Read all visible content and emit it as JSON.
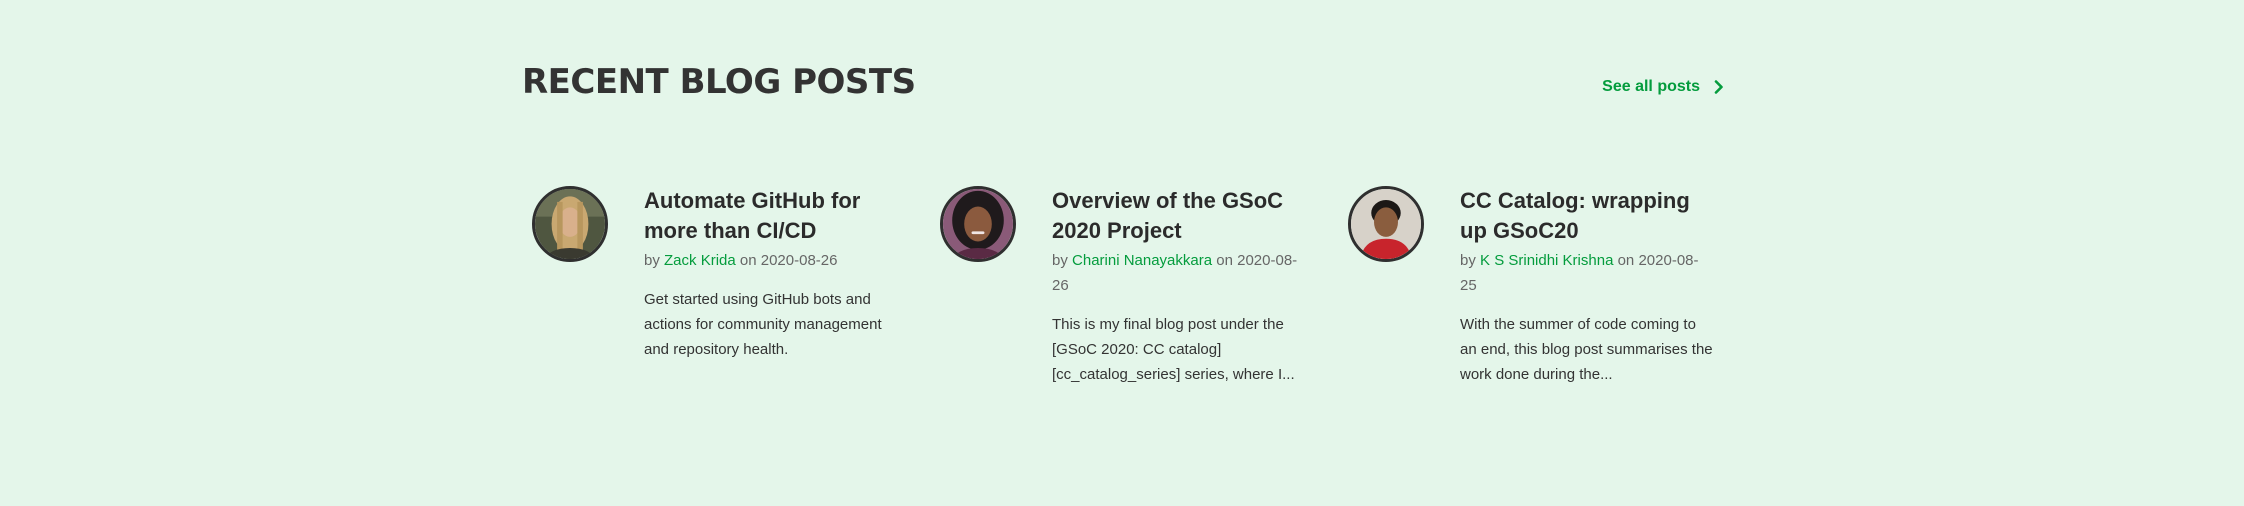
{
  "section": {
    "title": "RECENT BLOG POSTS",
    "see_all_label": "See all posts"
  },
  "posts": [
    {
      "title": "Automate GitHub for more than CI/CD",
      "by": "by",
      "author": "Zack Krida",
      "on": "on",
      "date": "2020-08-26",
      "excerpt": "Get started using GitHub bots and actions for community management and repository health."
    },
    {
      "title": "Overview of the GSoC 2020 Project",
      "by": "by",
      "author": "Charini Nanayakkara",
      "on": "on",
      "date": "2020-08-26",
      "excerpt": "This is my final blog post under the [GSoC 2020: CC catalog][cc_catalog_series] series, where I..."
    },
    {
      "title": "CC Catalog: wrapping up GSoC20",
      "by": "by",
      "author": "K S Srinidhi Krishna",
      "on": "on",
      "date": "2020-08-25",
      "excerpt": "With the summer of code coming to an end, this blog post summarises the work done during the..."
    }
  ],
  "colors": {
    "background": "#e4f6ea",
    "accent": "#049c3d",
    "heading": "#333333"
  },
  "icons": {
    "see_all": "chevron-right-icon"
  }
}
